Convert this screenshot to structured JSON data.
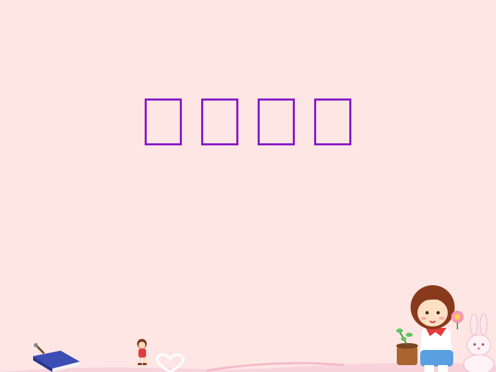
{
  "slide": {
    "title_chars": [
      "",
      "",
      "",
      ""
    ],
    "title_color": "#8a18c8",
    "background_color": "#fde6e4"
  },
  "decorations": {
    "icons": [
      "book-icon",
      "small-girl-icon",
      "heart-icon",
      "girl-with-plant-illustration",
      "bunny-icon",
      "flower-icon",
      "pink-ground-curve"
    ]
  }
}
